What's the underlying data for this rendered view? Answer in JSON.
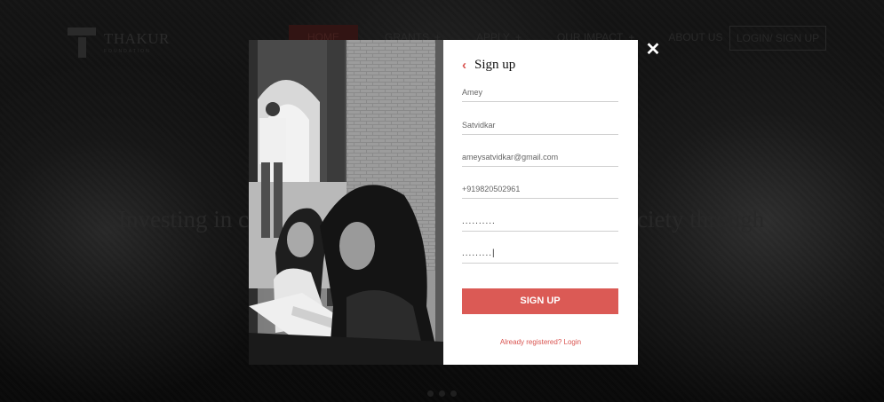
{
  "brand": {
    "name": "THAKUR",
    "sub": "FOUNDATION"
  },
  "nav": {
    "items": [
      {
        "label": "HOME"
      },
      {
        "label": "GRANTS",
        "plus": "+"
      },
      {
        "label": "APPLY",
        "plus": "+"
      },
      {
        "label": "OUR IMPACT",
        "plus": "+"
      },
      {
        "label": "ABOUT US"
      }
    ],
    "login_label": "LOGIN/ SIGN UP"
  },
  "hero": {
    "left_text": "Investing in c",
    "right_text": "ciety through"
  },
  "modal": {
    "close_glyph": "✕",
    "back_glyph": "‹",
    "title": "Sign up",
    "fields": {
      "first_name": "Amey",
      "last_name": "Satvidkar",
      "email": "ameysatvidkar@gmail.com",
      "phone": "+919820502961",
      "password": "..........",
      "confirm_password": ".........|"
    },
    "submit_label": "SIGN UP",
    "login_link": "Already registered? Login"
  },
  "colors": {
    "accent": "#db5a55",
    "link": "#d9534f",
    "overlay": "#000000"
  },
  "carousel": {
    "dots": 3
  }
}
